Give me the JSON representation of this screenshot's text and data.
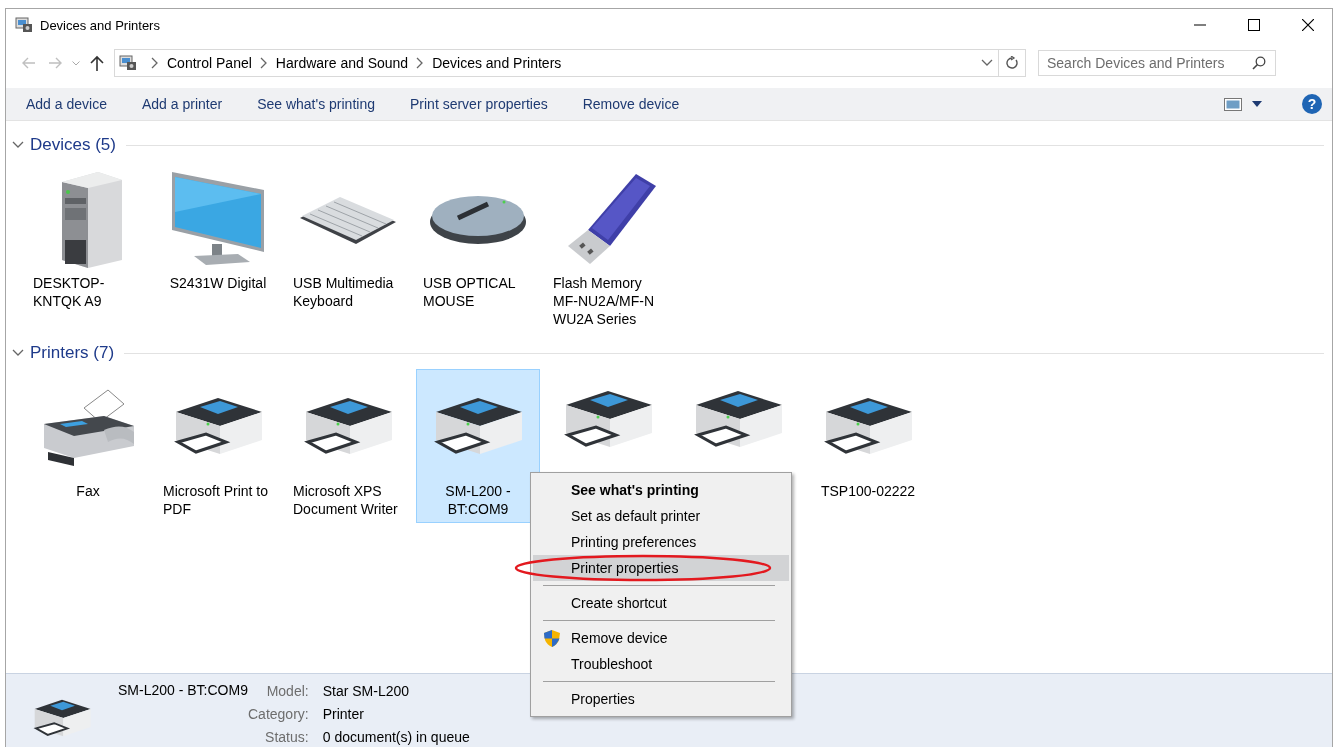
{
  "window": {
    "title": "Devices and Printers"
  },
  "navigation": {
    "back_disabled": true,
    "forward_disabled": true
  },
  "breadcrumb": [
    "Control Panel",
    "Hardware and Sound",
    "Devices and Printers"
  ],
  "search": {
    "placeholder": "Search Devices and Printers"
  },
  "toolbar": {
    "actions": [
      "Add a device",
      "Add a printer",
      "See what's printing",
      "Print server properties",
      "Remove device"
    ],
    "help": "?"
  },
  "sections": [
    {
      "title": "Devices (5)",
      "expanded": true,
      "items": [
        {
          "label": "DESKTOP-KNTQK A9",
          "kind": "computer",
          "selected": false
        },
        {
          "label": "S2431W Digital",
          "kind": "monitor",
          "selected": false
        },
        {
          "label": "USB Multimedia Keyboard",
          "kind": "keyboard",
          "selected": false
        },
        {
          "label": "USB OPTICAL MOUSE",
          "kind": "mouse",
          "selected": false
        },
        {
          "label": "Flash Memory MF-NU2A/MF-N WU2A Series",
          "kind": "usb",
          "selected": false
        }
      ]
    },
    {
      "title": "Printers (7)",
      "expanded": true,
      "items": [
        {
          "label": "Fax",
          "kind": "fax",
          "selected": false
        },
        {
          "label": "Microsoft Print to PDF",
          "kind": "printer",
          "selected": false
        },
        {
          "label": "Microsoft XPS Document Writer",
          "kind": "printer",
          "selected": false
        },
        {
          "label": "SM-L200 - BT:COM9",
          "kind": "printer",
          "selected": true
        },
        {
          "kind": "printer",
          "selected": false
        },
        {
          "kind": "printer",
          "selected": false
        },
        {
          "label": "TSP100-02222",
          "kind": "printer",
          "selected": false
        }
      ]
    }
  ],
  "context_menu": {
    "items": [
      {
        "kind": "item",
        "label": "See what's printing",
        "default": true,
        "selected": false,
        "circled": false,
        "shield": false
      },
      {
        "kind": "item",
        "label": "Set as default printer",
        "default": false,
        "selected": false,
        "circled": false,
        "shield": false
      },
      {
        "kind": "item",
        "label": "Printing preferences",
        "default": false,
        "selected": false,
        "circled": false,
        "shield": false
      },
      {
        "kind": "item",
        "label": "Printer properties",
        "default": false,
        "selected": true,
        "circled": true,
        "shield": false
      },
      {
        "kind": "separator"
      },
      {
        "kind": "item",
        "label": "Create shortcut",
        "default": false,
        "selected": false,
        "circled": false,
        "shield": false
      },
      {
        "kind": "separator"
      },
      {
        "kind": "item",
        "label": "Remove device",
        "default": false,
        "selected": false,
        "circled": false,
        "shield": true
      },
      {
        "kind": "item",
        "label": "Troubleshoot",
        "default": false,
        "selected": false,
        "circled": false,
        "shield": false
      },
      {
        "kind": "separator"
      },
      {
        "kind": "item",
        "label": "Properties",
        "default": false,
        "selected": false,
        "circled": false,
        "shield": false
      }
    ]
  },
  "details": {
    "name": "SM-L200 - BT:COM9",
    "kind": "printer",
    "fields": [
      {
        "label": "Model:",
        "value": "Star SM-L200"
      },
      {
        "label": "Category:",
        "value": "Printer"
      },
      {
        "label": "Status:",
        "value": "0 document(s) in queue"
      }
    ]
  }
}
